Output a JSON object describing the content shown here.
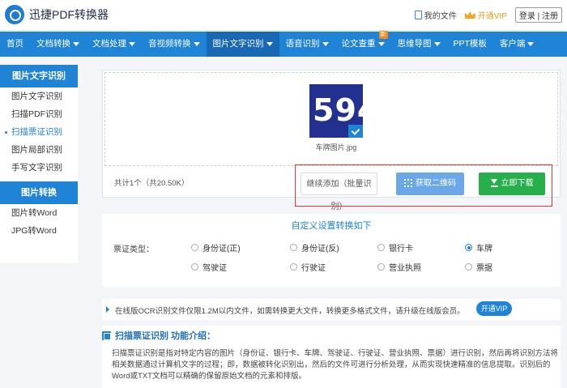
{
  "header": {
    "logo_text": "迅捷PDF转换器",
    "my_files": "我的文件",
    "vip": "开通VIP",
    "login": "登录 | 注册"
  },
  "nav": {
    "items": [
      {
        "label": "首页",
        "dropdown": false
      },
      {
        "label": "文档转换",
        "dropdown": true
      },
      {
        "label": "文档处理",
        "dropdown": true
      },
      {
        "label": "音视频转换",
        "dropdown": true
      },
      {
        "label": "图片文字识别",
        "dropdown": true,
        "active": true
      },
      {
        "label": "语音识别",
        "dropdown": true
      },
      {
        "label": "论文查重",
        "dropdown": true,
        "badge": "新"
      },
      {
        "label": "思维导图",
        "dropdown": true
      },
      {
        "label": "PPT模板",
        "dropdown": false
      },
      {
        "label": "客户端",
        "dropdown": true
      }
    ]
  },
  "sidebar": {
    "group1_title": "图片文字识别",
    "group1_items": [
      "图片文字识别",
      "扫描PDF识别",
      "扫描票证识别",
      "图片局部识别",
      "手写文字识别"
    ],
    "group2_title": "图片转换",
    "group2_items": [
      "图片转Word",
      "JPG转Word"
    ]
  },
  "upload": {
    "thumbnail_text": "594",
    "file_name": "车牌图片.jpg",
    "file_info": "共计1个（共20.50K）",
    "add_button": "继续添加（批量识别）",
    "qr_button": "获取二维码",
    "download_button": "立即下载"
  },
  "settings": {
    "title": "自定义设置转换如下",
    "type_label": "票证类型：",
    "options": [
      {
        "label": "身份证(正)",
        "checked": false
      },
      {
        "label": "身份证(反)",
        "checked": false
      },
      {
        "label": "银行卡",
        "checked": false
      },
      {
        "label": "车牌",
        "checked": true
      },
      {
        "label": "驾驶证",
        "checked": false
      },
      {
        "label": "行驶证",
        "checked": false
      },
      {
        "label": "营业执照",
        "checked": false
      },
      {
        "label": "票据",
        "checked": false
      }
    ]
  },
  "notice": {
    "text": "在线版OCR识别文件仅限1.2M以内文件，如需转换更大文件，转换更多格式文件，请升级在线版会员。",
    "vip_button": "开通VIP"
  },
  "intro": {
    "title": "扫描票证识别 功能介绍：",
    "body": "扫描票证识别是指对特定内容的图片（身份证、银行卡、车牌、驾驶证、行驶证、营业执照、票据）进行识别，然后再将识别方法将相关数据通过计算机文字的过程；即，数据被转化识别出，然后的文件可进行分析处理，从而实现快速精准的信息提取。识别后的Word或TXT文档可以精确的保留原始文档的元素和排版。",
    "colors": {
      "accent": "#1f83d6",
      "download": "#26b04b",
      "highlight": "#ee3333"
    }
  }
}
